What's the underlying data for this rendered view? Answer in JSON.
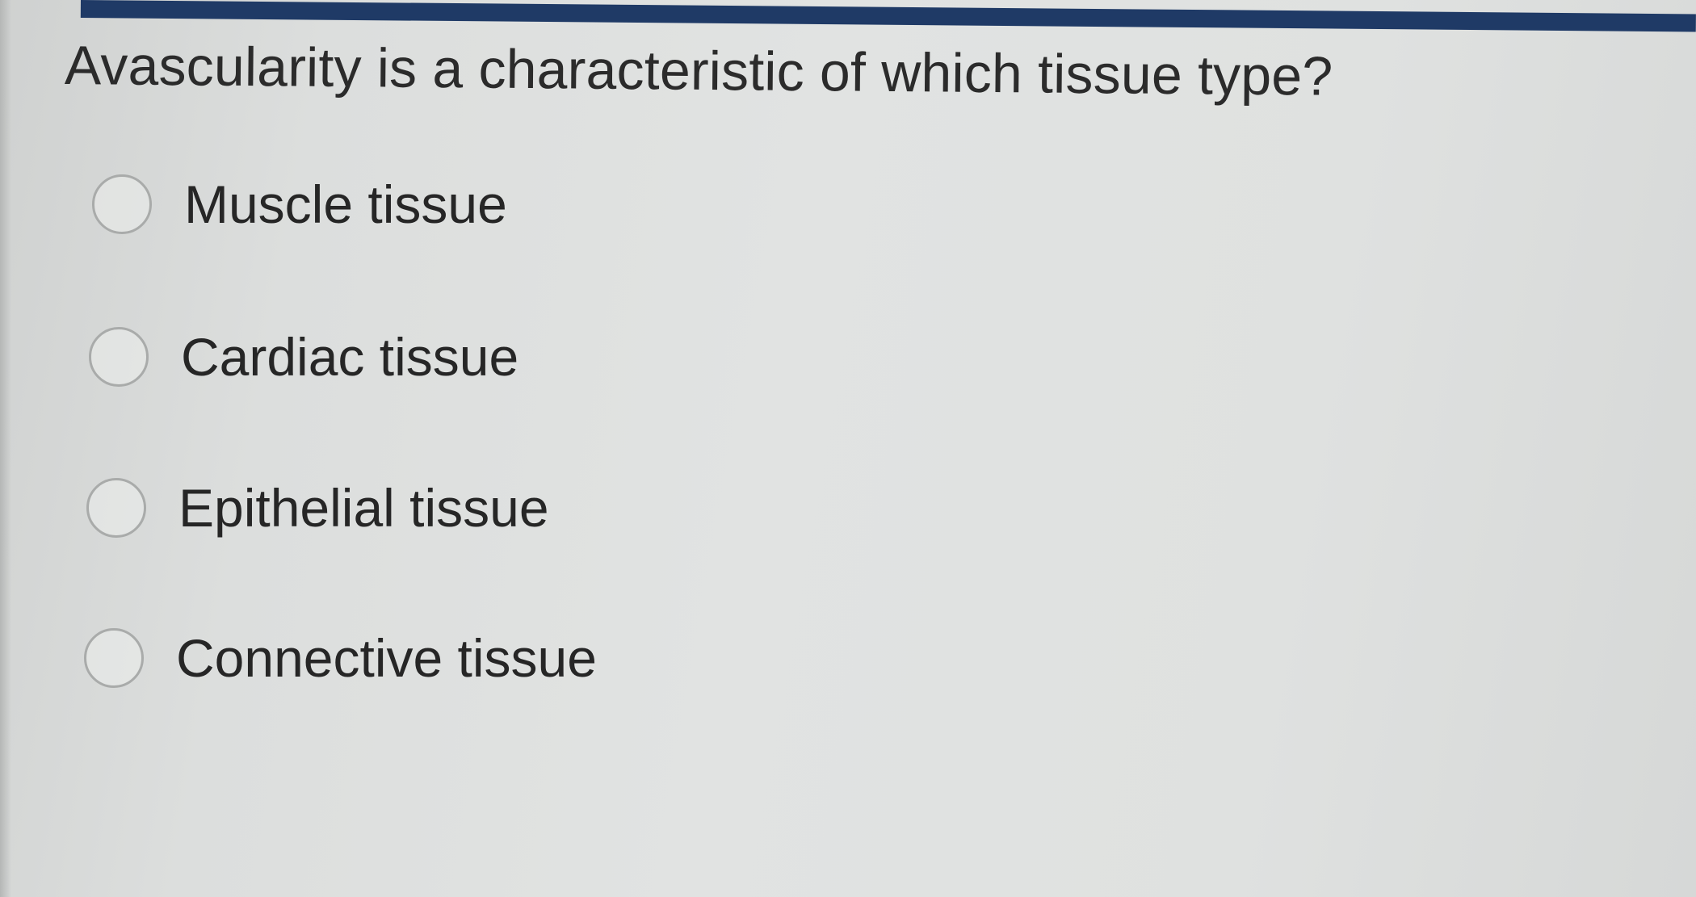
{
  "quiz": {
    "question": "Avascularity is a characteristic of which tissue type?",
    "options": [
      {
        "label": "Muscle tissue",
        "selected": false
      },
      {
        "label": "Cardiac tissue",
        "selected": false
      },
      {
        "label": "Epithelial tissue",
        "selected": false
      },
      {
        "label": "Connective tissue",
        "selected": false
      }
    ]
  },
  "colors": {
    "header_bar": "#1f3a66",
    "background": "#dfe1e0",
    "text": "#2b2b2b",
    "radio_border": "#a9abaa"
  }
}
